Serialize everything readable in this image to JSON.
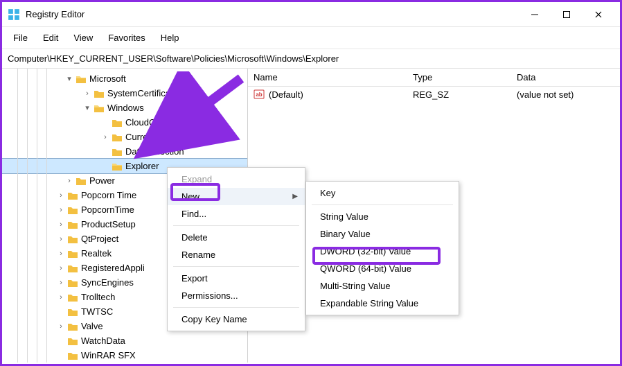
{
  "titlebar": {
    "title": "Registry Editor"
  },
  "menubar": {
    "items": [
      "File",
      "Edit",
      "View",
      "Favorites",
      "Help"
    ]
  },
  "addressbar": {
    "path": "Computer\\HKEY_CURRENT_USER\\Software\\Policies\\Microsoft\\Windows\\Explorer"
  },
  "tree": {
    "microsoft": "Microsoft",
    "systemcerts": "SystemCertificates",
    "windows": "Windows",
    "cloudcontent": "CloudContent",
    "currentversion": "CurrentVersion",
    "datacollection": "DataCollection",
    "explorer": "Explorer",
    "power": "Power",
    "popcorn_time": "Popcorn Time",
    "popcorntime": "PopcornTime",
    "productsetup": "ProductSetup",
    "qtproject": "QtProject",
    "realtek": "Realtek",
    "registeredappli": "RegisteredAppli",
    "syncengines": "SyncEngines",
    "trolltech": "Trolltech",
    "twtsc": "TWTSC",
    "valve": "Valve",
    "watchdata": "WatchData",
    "winrarsfx": "WinRAR SFX"
  },
  "list": {
    "headers": {
      "name": "Name",
      "type": "Type",
      "data": "Data"
    },
    "rows": [
      {
        "name": "(Default)",
        "type": "REG_SZ",
        "data": "(value not set)"
      }
    ]
  },
  "context_menu": {
    "expand": "Expand",
    "new": "New",
    "find": "Find...",
    "delete": "Delete",
    "rename": "Rename",
    "export": "Export",
    "permissions": "Permissions...",
    "copy_key_name": "Copy Key Name"
  },
  "new_submenu": {
    "key": "Key",
    "string": "String Value",
    "binary": "Binary Value",
    "dword32": "DWORD (32-bit) Value",
    "qword64": "QWORD (64-bit) Value",
    "multistring": "Multi-String Value",
    "expandable": "Expandable String Value"
  }
}
